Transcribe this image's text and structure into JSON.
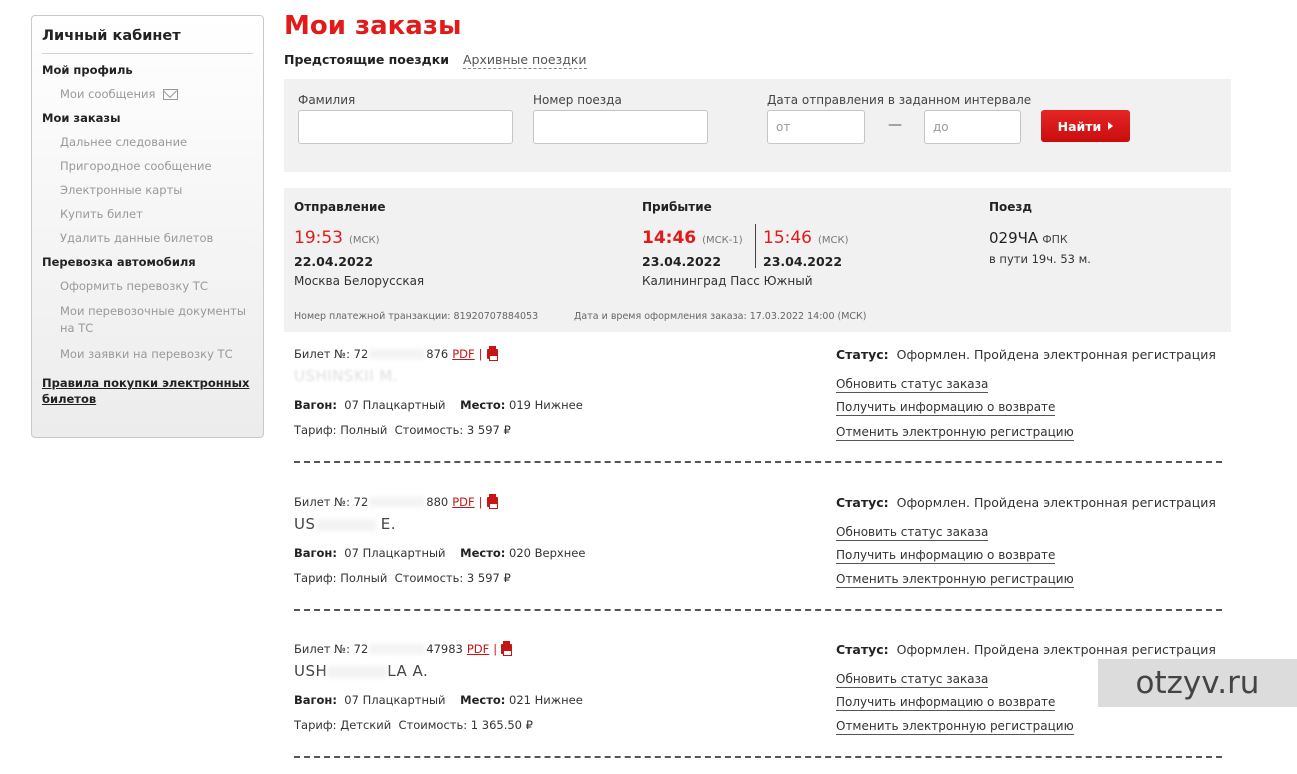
{
  "sidebar": {
    "title": "Личный кабинет",
    "profile_section": "Мой профиль",
    "messages": "Мои сообщения",
    "orders_section": "Мои заказы",
    "orders_items": [
      "Дальнее следование",
      "Пригородное сообщение",
      "Электронные карты",
      "Купить билет",
      "Удалить данные билетов"
    ],
    "car_section": "Перевозка автомобиля",
    "car_items": [
      "Оформить перевозку ТС",
      "Мои перевозочные документы на ТС",
      "Мои заявки на перевозку ТС"
    ],
    "rules_link": "Правила покупки электронных билетов"
  },
  "page_title": "Мои заказы",
  "tabs": {
    "active": "Предстоящие поездки",
    "archive": "Архивные поездки"
  },
  "search": {
    "surname_label": "Фамилия",
    "surname_value": "",
    "train_label": "Номер поезда",
    "train_value": "",
    "date_label": "Дата отправления в заданном интервале",
    "from_placeholder": "от",
    "to_placeholder": "до",
    "dash": "—",
    "find_button": "Найти"
  },
  "trip": {
    "departure_header": "Отправление",
    "arrival_header": "Прибытие",
    "train_header": "Поезд",
    "dep_time": "19:53",
    "dep_tz": "(МСК)",
    "dep_date": "22.04.2022",
    "dep_station": "Москва Белорусская",
    "arr_time_local": "14:46",
    "arr_tz_local": "(МСК-1)",
    "arr_time_msk": "15:46",
    "arr_tz_msk": "(МСК)",
    "arr_date_local": "23.04.2022",
    "arr_date_msk": "23.04.2022",
    "arr_station": "Калининград Пасс Южный",
    "train_number": "029ЧА",
    "train_carrier": "ФПК",
    "travel_time": "в пути 19ч. 53 м.",
    "transaction": "Номер платежной транзакции:  81920707884053",
    "order_date": "Дата и время оформления заказа:  17.03.2022   14:00   (МСК)"
  },
  "tickets": [
    {
      "num_prefix": "Билет №: 72",
      "num_suffix": "876",
      "name_clear": "",
      "name_end": "USHINSKII M.",
      "car_label": "Вагон:",
      "car": "07 Плацкартный",
      "seat_label": "Место:",
      "seat": "019 Нижнее",
      "tariff": "Тариф: Полный",
      "cost": "Стоимость: 3 597 ₽"
    },
    {
      "num_prefix": "Билет №: 72",
      "num_suffix": "880",
      "name_clear": "US",
      "name_end": "E.",
      "car_label": "Вагон:",
      "car": "07 Плацкартный",
      "seat_label": "Место:",
      "seat": "020 Верхнее",
      "tariff": "Тариф: Полный",
      "cost": "Стоимость: 3 597 ₽"
    },
    {
      "num_prefix": "Билет №: 72",
      "num_suffix": "47983",
      "name_clear": "USH",
      "name_end": "LA A.",
      "car_label": "Вагон:",
      "car": "07 Плацкартный",
      "seat_label": "Место:",
      "seat": "021 Нижнее",
      "tariff": "Тариф: Детский",
      "cost": "Стоимость: 1 365.50 ₽"
    }
  ],
  "ticket_common": {
    "pdf": "PDF",
    "pipe": "|",
    "status_label": "Статус:",
    "status_value": "Оформлен. Пройдена электронная регистрация",
    "link_update": "Обновить статус заказа",
    "link_refund": "Получить информацию о возврате",
    "link_cancel": "Отменить электронную регистрацию"
  },
  "watermark": "otzyv.ru",
  "colors": {
    "accent": "#e21a1a",
    "panel": "#f1f1f1"
  }
}
